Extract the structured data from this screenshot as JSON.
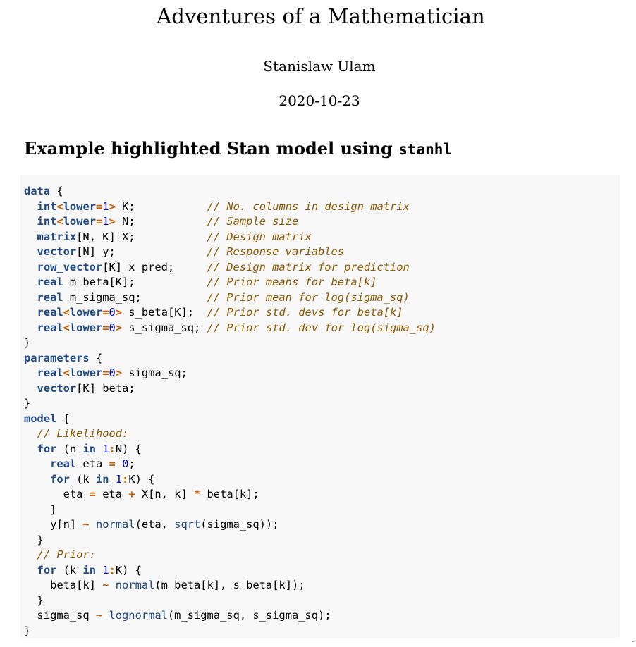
{
  "document": {
    "title": "Adventures of a Mathematician",
    "author": "Stanislaw Ulam",
    "date": "2020-10-23"
  },
  "section": {
    "heading": "Example highlighted Stan model using ",
    "heading_code": "stanhl"
  },
  "colors": {
    "keyword": "#204a87",
    "function": "#204a87",
    "operator": "#ce5c00",
    "number": "#0000cf",
    "comment": "#8f5902",
    "code_background": "#f8f8f8"
  },
  "code_lines": [
    [
      [
        "kw",
        "data"
      ],
      [
        "p",
        " {"
      ]
    ],
    [
      [
        "p",
        "  "
      ],
      [
        "kw",
        "int"
      ],
      [
        "op",
        "<"
      ],
      [
        "kw",
        "lower"
      ],
      [
        "op",
        "="
      ],
      [
        "num",
        "1"
      ],
      [
        "op",
        ">"
      ],
      [
        "p",
        " K;           "
      ],
      [
        "com",
        "// No. columns in design matrix"
      ]
    ],
    [
      [
        "p",
        "  "
      ],
      [
        "kw",
        "int"
      ],
      [
        "op",
        "<"
      ],
      [
        "kw",
        "lower"
      ],
      [
        "op",
        "="
      ],
      [
        "num",
        "1"
      ],
      [
        "op",
        ">"
      ],
      [
        "p",
        " N;           "
      ],
      [
        "com",
        "// Sample size"
      ]
    ],
    [
      [
        "p",
        "  "
      ],
      [
        "kw",
        "matrix"
      ],
      [
        "p",
        "[N, K] X;           "
      ],
      [
        "com",
        "// Design matrix"
      ]
    ],
    [
      [
        "p",
        "  "
      ],
      [
        "kw",
        "vector"
      ],
      [
        "p",
        "[N] y;              "
      ],
      [
        "com",
        "// Response variables"
      ]
    ],
    [
      [
        "p",
        "  "
      ],
      [
        "kw",
        "row_vector"
      ],
      [
        "p",
        "[K] x_pred;     "
      ],
      [
        "com",
        "// Design matrix for prediction"
      ]
    ],
    [
      [
        "p",
        "  "
      ],
      [
        "kw",
        "real"
      ],
      [
        "p",
        " m_beta[K];           "
      ],
      [
        "com",
        "// Prior means for beta[k]"
      ]
    ],
    [
      [
        "p",
        "  "
      ],
      [
        "kw",
        "real"
      ],
      [
        "p",
        " m_sigma_sq;          "
      ],
      [
        "com",
        "// Prior mean for log(sigma_sq)"
      ]
    ],
    [
      [
        "p",
        "  "
      ],
      [
        "kw",
        "real"
      ],
      [
        "op",
        "<"
      ],
      [
        "kw",
        "lower"
      ],
      [
        "op",
        "="
      ],
      [
        "num",
        "0"
      ],
      [
        "op",
        ">"
      ],
      [
        "p",
        " s_beta[K];  "
      ],
      [
        "com",
        "// Prior std. devs for beta[k]"
      ]
    ],
    [
      [
        "p",
        "  "
      ],
      [
        "kw",
        "real"
      ],
      [
        "op",
        "<"
      ],
      [
        "kw",
        "lower"
      ],
      [
        "op",
        "="
      ],
      [
        "num",
        "0"
      ],
      [
        "op",
        ">"
      ],
      [
        "p",
        " s_sigma_sq; "
      ],
      [
        "com",
        "// Prior std. dev for log(sigma_sq)"
      ]
    ],
    [
      [
        "p",
        "}"
      ]
    ],
    [
      [
        "kw",
        "parameters"
      ],
      [
        "p",
        " {"
      ]
    ],
    [
      [
        "p",
        "  "
      ],
      [
        "kw",
        "real"
      ],
      [
        "op",
        "<"
      ],
      [
        "kw",
        "lower"
      ],
      [
        "op",
        "="
      ],
      [
        "num",
        "0"
      ],
      [
        "op",
        ">"
      ],
      [
        "p",
        " sigma_sq;"
      ]
    ],
    [
      [
        "p",
        "  "
      ],
      [
        "kw",
        "vector"
      ],
      [
        "p",
        "[K] beta;"
      ]
    ],
    [
      [
        "p",
        "}"
      ]
    ],
    [
      [
        "kw",
        "model"
      ],
      [
        "p",
        " {"
      ]
    ],
    [
      [
        "p",
        "  "
      ],
      [
        "com",
        "// Likelihood:"
      ]
    ],
    [
      [
        "p",
        "  "
      ],
      [
        "kw",
        "for"
      ],
      [
        "p",
        " (n "
      ],
      [
        "kw",
        "in"
      ],
      [
        "p",
        " "
      ],
      [
        "num",
        "1"
      ],
      [
        "op",
        ":"
      ],
      [
        "p",
        "N) {"
      ]
    ],
    [
      [
        "p",
        "    "
      ],
      [
        "kw",
        "real"
      ],
      [
        "p",
        " eta "
      ],
      [
        "op",
        "="
      ],
      [
        "p",
        " "
      ],
      [
        "num",
        "0"
      ],
      [
        "p",
        ";"
      ]
    ],
    [
      [
        "p",
        "    "
      ],
      [
        "kw",
        "for"
      ],
      [
        "p",
        " (k "
      ],
      [
        "kw",
        "in"
      ],
      [
        "p",
        " "
      ],
      [
        "num",
        "1"
      ],
      [
        "op",
        ":"
      ],
      [
        "p",
        "K) {"
      ]
    ],
    [
      [
        "p",
        "      eta "
      ],
      [
        "op",
        "="
      ],
      [
        "p",
        " eta "
      ],
      [
        "op",
        "+"
      ],
      [
        "p",
        " X[n, k] "
      ],
      [
        "op",
        "*"
      ],
      [
        "p",
        " beta[k];"
      ]
    ],
    [
      [
        "p",
        "    }"
      ]
    ],
    [
      [
        "p",
        "    y[n] "
      ],
      [
        "op",
        "~"
      ],
      [
        "p",
        " "
      ],
      [
        "fn",
        "normal"
      ],
      [
        "p",
        "(eta, "
      ],
      [
        "fn",
        "sqrt"
      ],
      [
        "p",
        "(sigma_sq));"
      ]
    ],
    [
      [
        "p",
        "  }"
      ]
    ],
    [
      [
        "p",
        "  "
      ],
      [
        "com",
        "// Prior:"
      ]
    ],
    [
      [
        "p",
        "  "
      ],
      [
        "kw",
        "for"
      ],
      [
        "p",
        " (k "
      ],
      [
        "kw",
        "in"
      ],
      [
        "p",
        " "
      ],
      [
        "num",
        "1"
      ],
      [
        "op",
        ":"
      ],
      [
        "p",
        "K) {"
      ]
    ],
    [
      [
        "p",
        "    beta[k] "
      ],
      [
        "op",
        "~"
      ],
      [
        "p",
        " "
      ],
      [
        "fn",
        "normal"
      ],
      [
        "p",
        "(m_beta[k], s_beta[k]);"
      ]
    ],
    [
      [
        "p",
        "  }"
      ]
    ],
    [
      [
        "p",
        "  sigma_sq "
      ],
      [
        "op",
        "~"
      ],
      [
        "p",
        " "
      ],
      [
        "fn",
        "lognormal"
      ],
      [
        "p",
        "(m_sigma_sq, s_sigma_sq);"
      ]
    ],
    [
      [
        "p",
        "}"
      ]
    ]
  ]
}
